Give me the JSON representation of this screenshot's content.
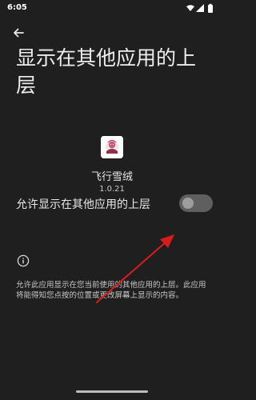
{
  "status_bar": {
    "time": "6:05",
    "icons": [
      "wifi-icon",
      "signal-icon",
      "battery-icon"
    ]
  },
  "header": {
    "back_icon": "arrow-left-icon",
    "title": "显示在其他应用的上层"
  },
  "app": {
    "name": "飞行雪绒",
    "version": "1.0.21"
  },
  "permission": {
    "label": "允许显示在其他应用的上层",
    "enabled": false
  },
  "info": {
    "icon": "info-icon",
    "description": "允许此应用显示在您当前使用的其他应用的上层。此应用将能得知您点按的位置或更改屏幕上显示的内容。"
  },
  "colors": {
    "background": "#1f1f1f",
    "toggle_track_off": "#5f5f5f",
    "toggle_knob_off": "#9e9e9e",
    "annotation_arrow": "#d81c1c"
  }
}
